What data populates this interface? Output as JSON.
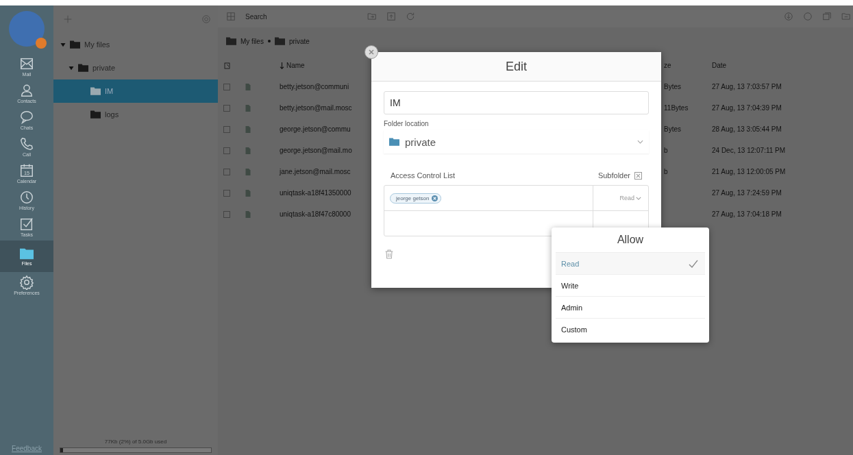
{
  "rail": {
    "items": [
      {
        "kind": "mail",
        "label": "Mail",
        "selected": false
      },
      {
        "kind": "contacts",
        "label": "Contacts",
        "selected": false
      },
      {
        "kind": "chats",
        "label": "Chats",
        "selected": false
      },
      {
        "kind": "call",
        "label": "Call",
        "selected": false
      },
      {
        "kind": "calendar",
        "label": "Calendar",
        "icon_text": "15",
        "selected": false
      },
      {
        "kind": "history",
        "label": "History",
        "selected": false
      },
      {
        "kind": "tasks",
        "label": "Tasks",
        "selected": false
      },
      {
        "kind": "files",
        "label": "Files",
        "selected": true
      },
      {
        "kind": "preferences",
        "label": "Preferences",
        "selected": false
      }
    ],
    "feedback": "Feedback"
  },
  "tree": {
    "items": [
      {
        "label": "My files",
        "expanded": true,
        "selected": false,
        "children": [
          {
            "label": "private",
            "expanded": true,
            "selected": false,
            "children": [
              {
                "label": "IM",
                "selected": true
              },
              {
                "label": "logs",
                "selected": false
              }
            ]
          }
        ]
      }
    ]
  },
  "storage": {
    "text": "77Kb (2%) of 5.0Gb used",
    "level": 0.02
  },
  "search": {
    "placeholder": "Search"
  },
  "breadcrumb": [
    "My files",
    "private"
  ],
  "table": {
    "columns": [
      "Name",
      "ze",
      "Date"
    ],
    "rows": [
      {
        "checked": false,
        "name": "betty.jetson@communi",
        "size": "Bytes",
        "date": "27 Aug, 13 7:03:57 PM"
      },
      {
        "checked": false,
        "name": "betty.jetson@mail.mosc",
        "size": "11Bytes",
        "date": "27 Aug, 13 7:04:39 PM"
      },
      {
        "checked": false,
        "name": "george.jetson@commu",
        "size": "Bytes",
        "date": "28 Aug, 13 3:05:44 PM"
      },
      {
        "checked": false,
        "name": "george.jetson@mail.mo",
        "size": "b",
        "date": "24 Dec, 13 12:07:11 PM"
      },
      {
        "checked": false,
        "name": "jane.jetson@mail.mosc",
        "size": "b",
        "date": "21 Aug, 13 12:00:05 PM"
      },
      {
        "checked": false,
        "name": "uniqtask-a18f41350000",
        "date": "27 Aug, 13 7:24:59 PM"
      },
      {
        "checked": false,
        "name": "uniqtask-a18f47c80000",
        "date": "27 Aug, 13 7:04:18 PM"
      }
    ]
  },
  "dialog": {
    "title": "Edit",
    "name_value": "IM",
    "location_label": "Folder location",
    "location_value": "private",
    "acl_label": "Access Control List",
    "subfolder_label": "Subfolder",
    "subfolder_checked": true,
    "acl": [
      {
        "user": "jeorge getson",
        "permission": "Read"
      }
    ]
  },
  "popover": {
    "title": "Allow",
    "options": [
      {
        "label": "Read",
        "selected": true
      },
      {
        "label": "Write",
        "selected": false
      },
      {
        "label": "Admin",
        "selected": false
      },
      {
        "label": "Custom",
        "selected": false
      }
    ]
  }
}
